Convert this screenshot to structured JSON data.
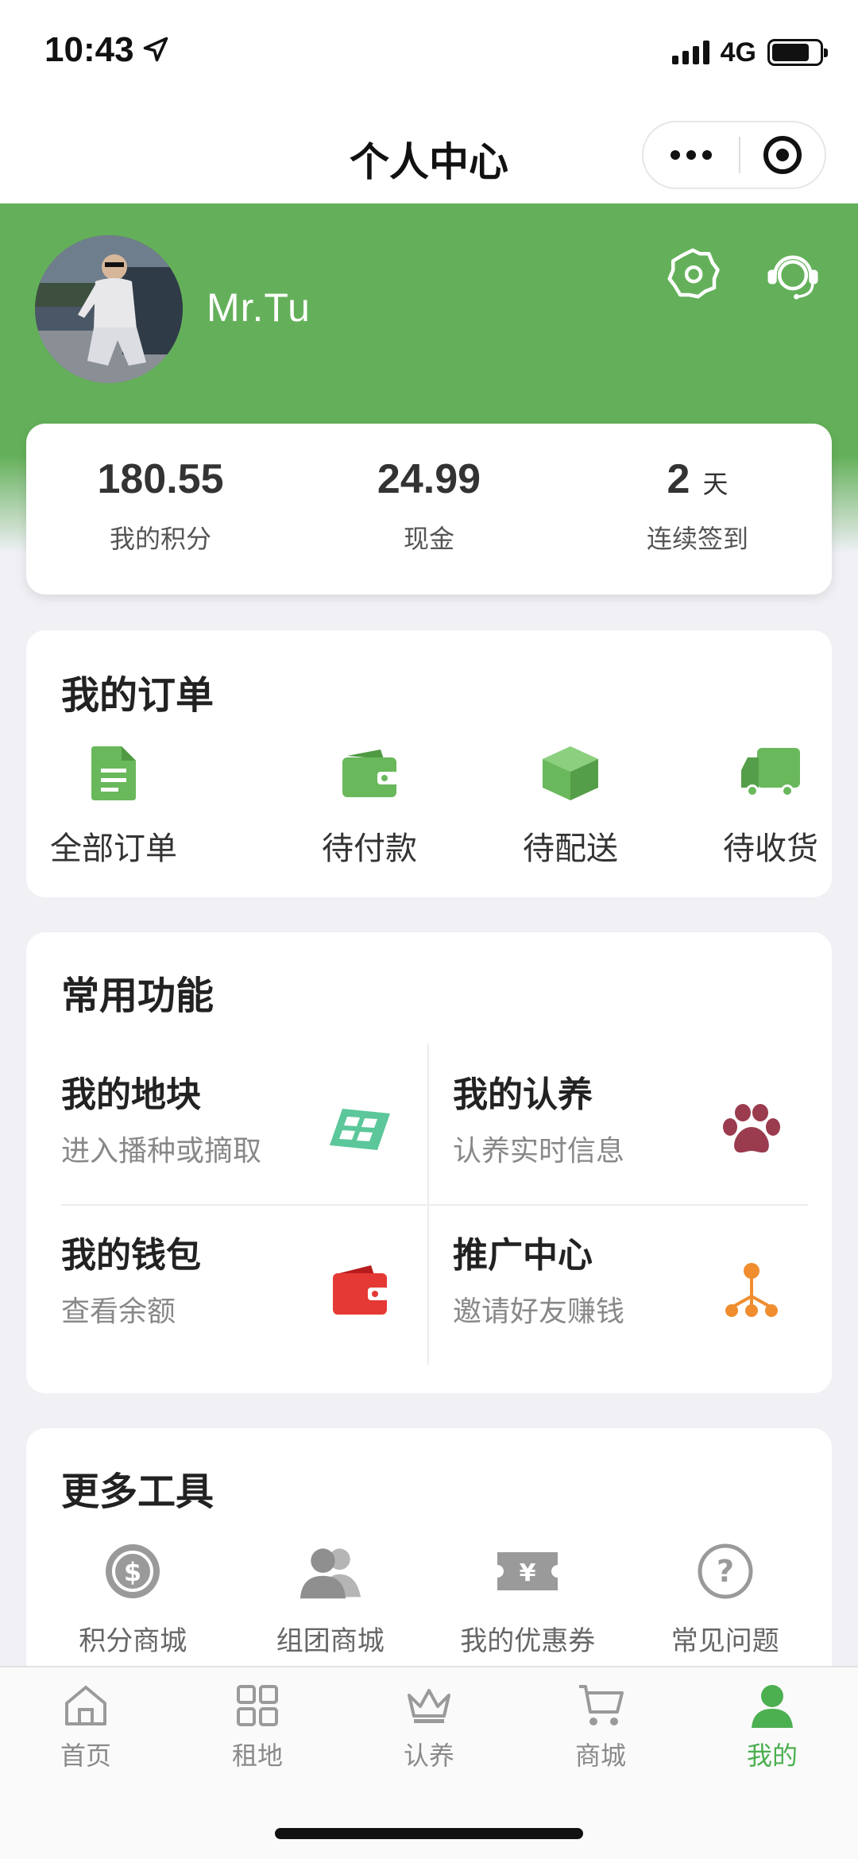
{
  "status_bar": {
    "time": "10:43",
    "network": "4G",
    "battery_level": 0.8
  },
  "nav": {
    "title": "个人中心"
  },
  "profile": {
    "username": "Mr.Tu"
  },
  "stats": [
    {
      "value": "180.55",
      "unit": "",
      "label": "我的积分"
    },
    {
      "value": "24.99",
      "unit": "",
      "label": "现金"
    },
    {
      "value": "2",
      "unit": "天",
      "label": "连续签到"
    }
  ],
  "orders": {
    "title": "我的订单",
    "items": [
      {
        "label": "全部订单",
        "icon": "document-icon"
      },
      {
        "label": "待付款",
        "icon": "wallet-icon"
      },
      {
        "label": "待配送",
        "icon": "box-icon"
      },
      {
        "label": "待收货",
        "icon": "truck-icon"
      }
    ]
  },
  "functions": {
    "title": "常用功能",
    "items": [
      {
        "title": "我的地块",
        "subtitle": "进入播种或摘取",
        "icon": "land-plot-icon",
        "color": "#5cc79a"
      },
      {
        "title": "我的认养",
        "subtitle": "认养实时信息",
        "icon": "paw-icon",
        "color": "#9b3b4e"
      },
      {
        "title": "我的钱包",
        "subtitle": "查看余额",
        "icon": "wallet-icon",
        "color": "#e53935"
      },
      {
        "title": "推广中心",
        "subtitle": "邀请好友赚钱",
        "icon": "network-icon",
        "color": "#ef8d2f"
      }
    ]
  },
  "tools": {
    "title": "更多工具",
    "items": [
      {
        "label": "积分商城",
        "icon": "coin-icon"
      },
      {
        "label": "组团商城",
        "icon": "group-icon"
      },
      {
        "label": "我的优惠券",
        "icon": "coupon-icon"
      },
      {
        "label": "常见问题",
        "icon": "question-icon"
      }
    ]
  },
  "tabbar": {
    "items": [
      {
        "label": "首页",
        "icon": "home-icon"
      },
      {
        "label": "租地",
        "icon": "grid-icon"
      },
      {
        "label": "认养",
        "icon": "crown-icon"
      },
      {
        "label": "商城",
        "icon": "cart-icon"
      },
      {
        "label": "我的",
        "icon": "user-icon",
        "active": true
      }
    ]
  },
  "colors": {
    "brand_green": "#64b05a",
    "icon_green": "#6ab85c",
    "active_tab": "#4caf50"
  }
}
